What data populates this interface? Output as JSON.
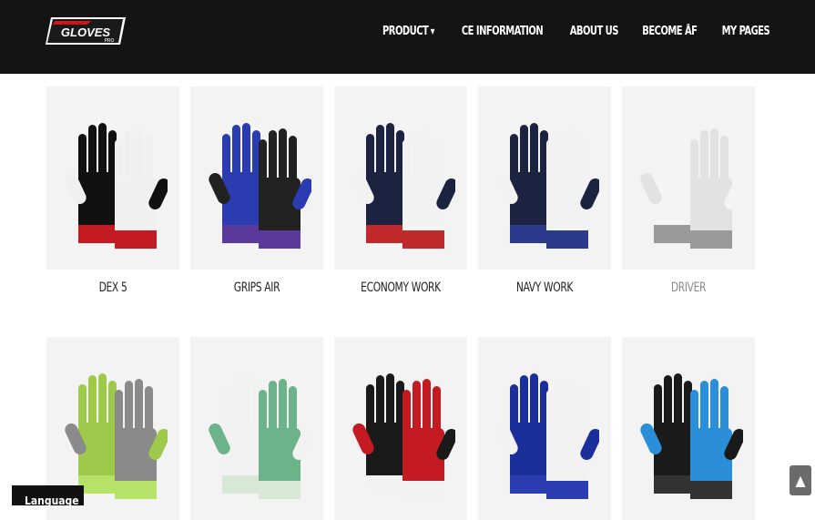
{
  "brand": {
    "logo_text": "GLOVES",
    "logo_sub": "PRO",
    "accent_color": "#d0121b"
  },
  "nav": {
    "items": [
      {
        "label": "PRODUCT",
        "has_dropdown": true
      },
      {
        "label": "CE INFORMATION"
      },
      {
        "label": "ABOUT US"
      },
      {
        "label": "BECOME ÅF"
      },
      {
        "label": "MY PAGES"
      }
    ],
    "dropdown_icon": "chevron-down-icon"
  },
  "products": [
    {
      "name": "DEX 5",
      "colors": [
        "#111111",
        "#f0f0f0",
        "#c41b22"
      ]
    },
    {
      "name": "GRIPS AIR",
      "colors": [
        "#2b3bb0",
        "#222222",
        "#5a3a9a"
      ]
    },
    {
      "name": "ECONOMY WORK",
      "colors": [
        "#1b2340",
        "#f2f2f2",
        "#c02a2a"
      ]
    },
    {
      "name": "NAVY WORK",
      "colors": [
        "#1b2340",
        "#f2f2f2",
        "#2b3a8a"
      ]
    },
    {
      "name": "DRIVER",
      "colors": [
        "#f4f4f4",
        "#e2e2e2",
        "#9a9a9a"
      ],
      "muted": true
    },
    {
      "name": "",
      "colors": [
        "#9ec94a",
        "#8a8a8a",
        "#b7e26a"
      ]
    },
    {
      "name": "",
      "colors": [
        "#f2f2f2",
        "#6db38a",
        "#d7e8d7"
      ]
    },
    {
      "name": "",
      "colors": [
        "#1a1a1a",
        "#c41b22",
        "#f2f2f2"
      ]
    },
    {
      "name": "",
      "colors": [
        "#1b2f9a",
        "#f2f2f2",
        "#2b3bb0"
      ]
    },
    {
      "name": "",
      "colors": [
        "#1a1a1a",
        "#2a8fd8",
        "#333333"
      ]
    }
  ],
  "footer": {
    "language_label": "Language",
    "scroll_top_icon": "arrow-up-icon"
  }
}
